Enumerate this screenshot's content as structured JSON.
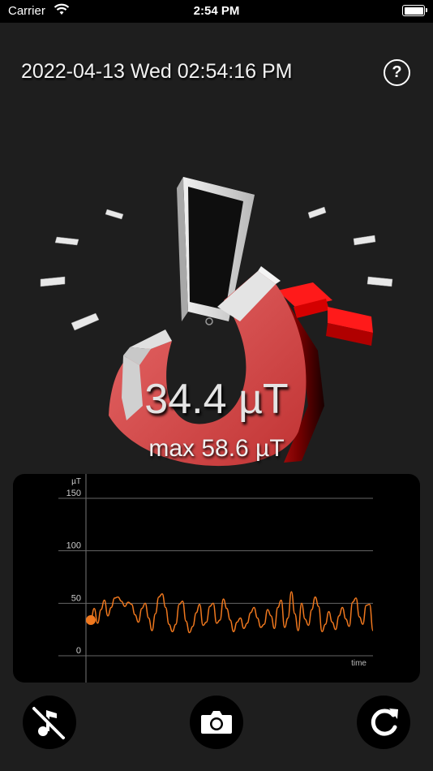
{
  "status_bar": {
    "carrier": "Carrier",
    "time": "2:54 PM"
  },
  "header": {
    "datetime": "2022-04-13 Wed 02:54:16 PM",
    "help_label": "?"
  },
  "meter": {
    "current": "34.4 µT",
    "max": "max 58.6 µT",
    "accent_color": "#ff1a1a"
  },
  "graph": {
    "unit_label": "µT",
    "y_ticks": [
      "150",
      "100",
      "50",
      "0"
    ],
    "x_label": "time",
    "line_color": "#f0781e",
    "chart_data": {
      "type": "line",
      "title": "",
      "ylabel": "µT",
      "xlabel": "time",
      "ylim": [
        0,
        150
      ],
      "grid": true,
      "series": [
        {
          "values": [
            34,
            45,
            31,
            44,
            53,
            38,
            46,
            55,
            56,
            52,
            47,
            51,
            49,
            39,
            32,
            45,
            50,
            36,
            24,
            40,
            56,
            59,
            46,
            30,
            23,
            30,
            49,
            52,
            33,
            22,
            28,
            41,
            49,
            29,
            32,
            47,
            50,
            31,
            34,
            54,
            45,
            34,
            23,
            32,
            36,
            26,
            31,
            41,
            46,
            36,
            27,
            30,
            44,
            38,
            26,
            46,
            53,
            27,
            36,
            61,
            40,
            24,
            50,
            35,
            29,
            44,
            56,
            47,
            23,
            30,
            42,
            32,
            25,
            38,
            46,
            35,
            28,
            51,
            55,
            37,
            30,
            48,
            49,
            24
          ]
        }
      ]
    }
  },
  "toolbar": {
    "icons": [
      "music-note-slash-icon",
      "camera-icon",
      "reset-icon"
    ]
  }
}
